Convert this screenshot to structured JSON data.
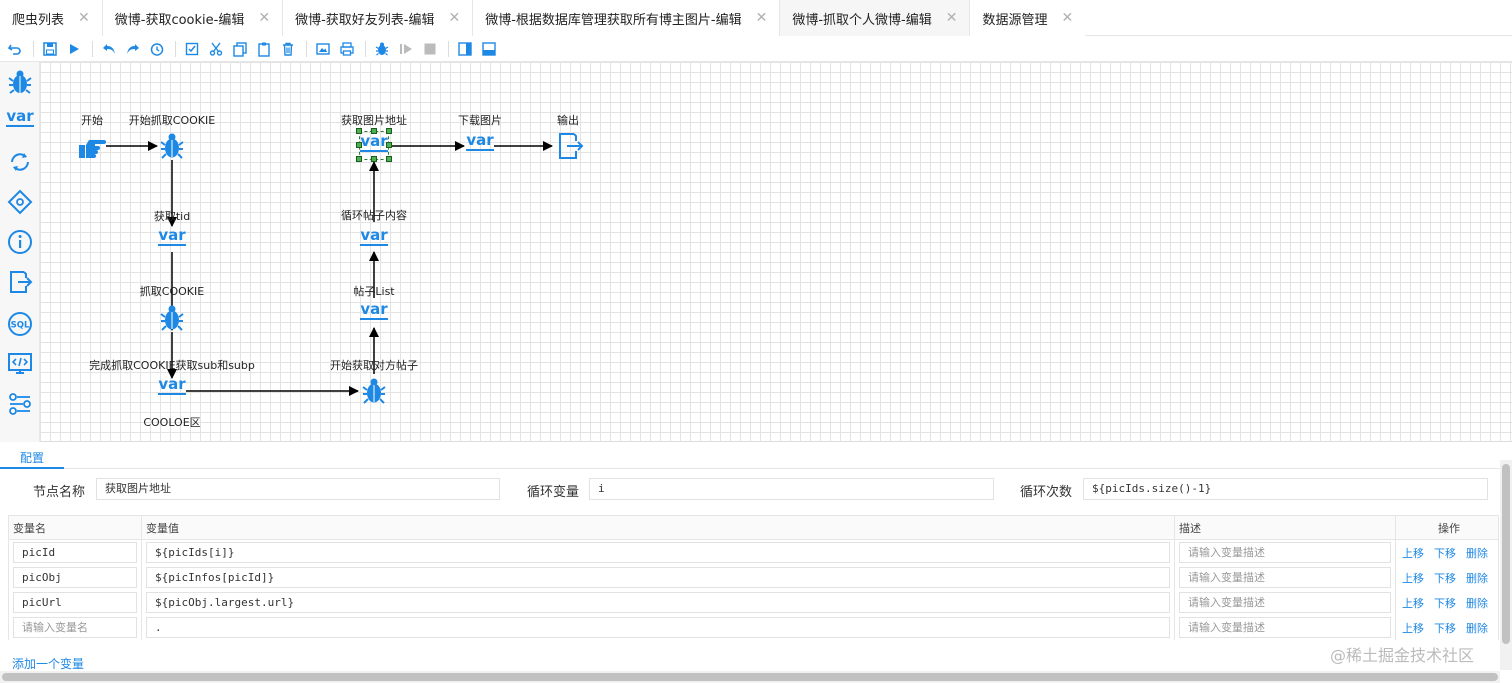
{
  "tabs": [
    {
      "label": "爬虫列表"
    },
    {
      "label": "微博-获取cookie-编辑"
    },
    {
      "label": "微博-获取好友列表-编辑"
    },
    {
      "label": "微博-根据数据库管理获取所有博主图片-编辑"
    },
    {
      "label": "微博-抓取个人微博-编辑"
    },
    {
      "label": "数据源管理"
    }
  ],
  "active_tab_index": 4,
  "palette": [
    "spider-icon",
    "var-icon",
    "loop-icon",
    "condition-icon",
    "info-icon",
    "output-icon",
    "sql-icon",
    "code-icon",
    "function-icon"
  ],
  "var_glyph": "var",
  "canvas": {
    "nodes": {
      "start": "开始",
      "start_cookie": "开始抓取COOKIE",
      "get_tid": "获取tid",
      "grab_cookie": "抓取COOKIE",
      "done_cookie": "完成抓取COOKIE获取sub和subp",
      "cookie_area": "COOLOE区",
      "start_posts": "开始获取对方帖子",
      "post_list": "帖子List",
      "loop_posts": "循环帖子内容",
      "get_img_url": "获取图片地址",
      "download_img": "下载图片",
      "output": "输出"
    }
  },
  "config": {
    "tab_label": "配置",
    "node_name_label": "节点名称",
    "node_name_value": "获取图片地址",
    "loop_var_label": "循环变量",
    "loop_var_value": "i",
    "loop_count_label": "循环次数",
    "loop_count_value": "${picIds.size()-1}"
  },
  "table": {
    "headers": {
      "name": "变量名",
      "value": "变量值",
      "desc": "描述",
      "ops": "操作"
    },
    "rows": [
      {
        "name": "picId",
        "value": "${picIds[i]}",
        "desc": "请输入变量描述"
      },
      {
        "name": "picObj",
        "value": "${picInfos[picId]}",
        "desc": "请输入变量描述"
      },
      {
        "name": "picUrl",
        "value": "${picObj.largest.url}",
        "desc": "请输入变量描述"
      },
      {
        "name": "请输入变量名",
        "value": ".",
        "desc": "请输入变量描述"
      }
    ],
    "ops": {
      "up": "上移",
      "down": "下移",
      "delete": "删除"
    },
    "add_label": "添加一个变量"
  },
  "watermark": "@稀土掘金技术社区",
  "colors": {
    "accent": "#1e88e5",
    "selection": "#4caf50"
  }
}
